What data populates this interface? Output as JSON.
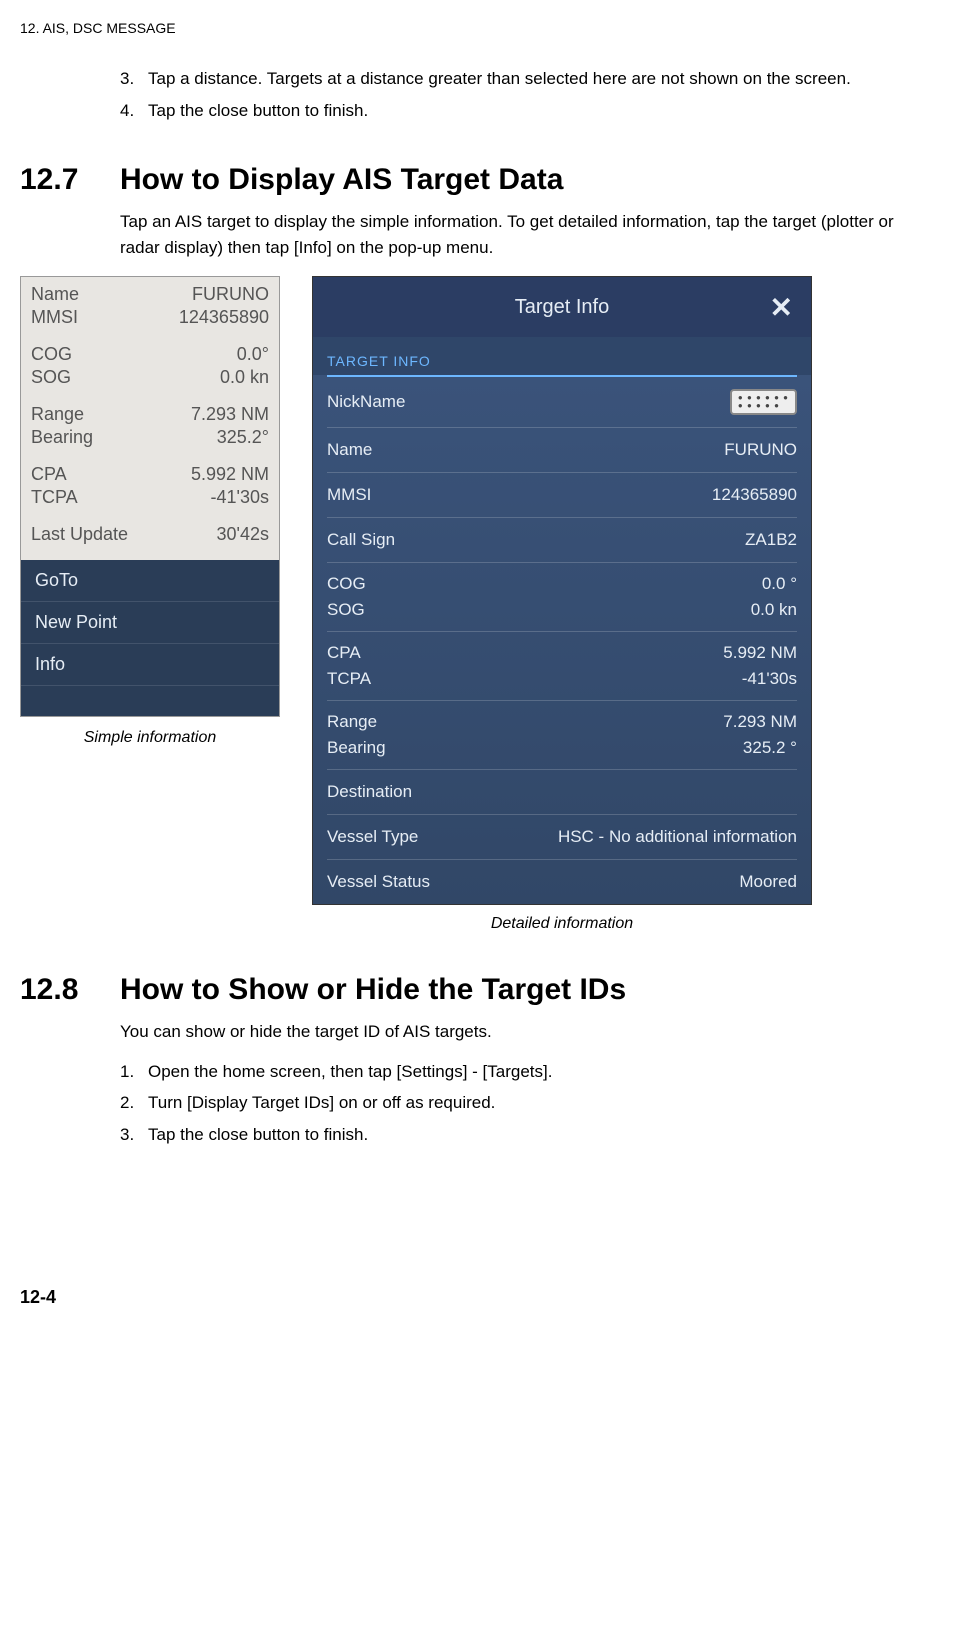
{
  "running_header": "12.  AIS, DSC MESSAGE",
  "intro_list": {
    "item3_num": "3.",
    "item3_text": "Tap a distance. Targets at a distance greater than selected here are not shown on the screen.",
    "item4_num": "4.",
    "item4_text": "Tap the close button to finish."
  },
  "section127": {
    "num": "12.7",
    "title": "How to Display AIS Target Data",
    "body": "Tap an AIS target to display the simple information. To get detailed information, tap the target (plotter or radar display) then tap [Info] on the pop-up menu."
  },
  "simple": {
    "rows": {
      "name_lbl": "Name",
      "name_val": "FURUNO",
      "mmsi_lbl": "MMSI",
      "mmsi_val": "124365890",
      "cog_lbl": "COG",
      "cog_val": "0.0°",
      "sog_lbl": "SOG",
      "sog_val": "0.0 kn",
      "range_lbl": "Range",
      "range_val": "7.293 NM",
      "bearing_lbl": "Bearing",
      "bearing_val": "325.2°",
      "cpa_lbl": "CPA",
      "cpa_val": "5.992 NM",
      "tcpa_lbl": "TCPA",
      "tcpa_val": "-41'30s",
      "last_lbl": "Last Update",
      "last_val": "30'42s"
    },
    "menu": {
      "goto": "GoTo",
      "newpoint": "New Point",
      "info": "Info"
    },
    "caption": "Simple information"
  },
  "detail": {
    "title": "Target Info",
    "section_label": "TARGET INFO",
    "rows": {
      "nickname_lbl": "NickName",
      "name_lbl": "Name",
      "name_val": "FURUNO",
      "mmsi_lbl": "MMSI",
      "mmsi_val": "124365890",
      "callsign_lbl": "Call Sign",
      "callsign_val": "ZA1B2",
      "cog_lbl": "COG",
      "cog_val": "0.0 °",
      "sog_lbl": "SOG",
      "sog_val": "0.0 kn",
      "cpa_lbl": "CPA",
      "cpa_val": "5.992 NM",
      "tcpa_lbl": "TCPA",
      "tcpa_val": "-41'30s",
      "range_lbl": "Range",
      "range_val": "7.293 NM",
      "bearing_lbl": "Bearing",
      "bearing_val": "325.2 °",
      "dest_lbl": "Destination",
      "vtype_lbl": "Vessel Type",
      "vtype_val": "HSC - No additional information",
      "vstatus_lbl": "Vessel Status",
      "vstatus_val": "Moored"
    },
    "caption": "Detailed information"
  },
  "section128": {
    "num": "12.8",
    "title": "How to Show or Hide the Target IDs",
    "body": "You can show or hide the target ID of AIS targets.",
    "item1_num": "1.",
    "item1_text": "Open the home screen, then tap [Settings] - [Targets].",
    "item2_num": "2.",
    "item2_text": "Turn [Display Target IDs] on or off as required.",
    "item3_num": "3.",
    "item3_text": "Tap the close button to finish."
  },
  "page_number": "12-4"
}
